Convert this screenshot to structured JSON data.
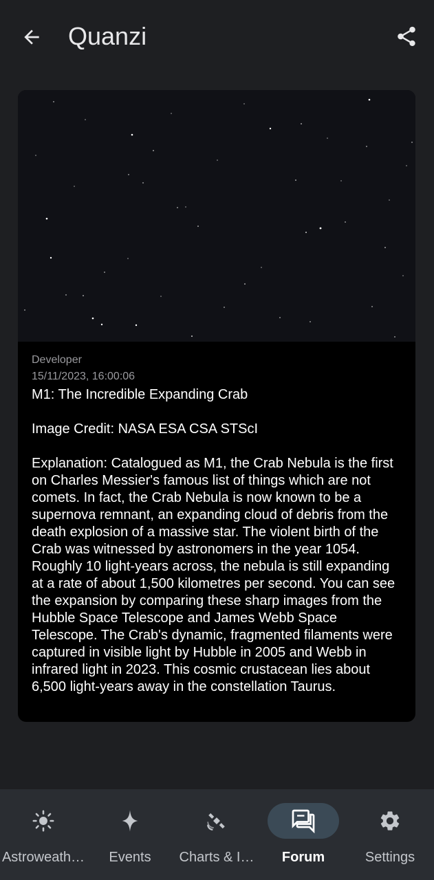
{
  "header": {
    "title": "Quanzi",
    "back_icon": "arrow-back-icon",
    "share_icon": "share-icon"
  },
  "post": {
    "image_alt": "starfield",
    "author": "Developer",
    "timestamp": "15/11/2023, 16:00:06",
    "text": "M1: The Incredible Expanding Crab\n\nImage Credit: NASA ESA CSA STScI\n\nExplanation: Catalogued as M1, the Crab Nebula is the first on Charles Messier's famous list of things which are not comets. In fact, the Crab Nebula is now known to be a supernova remnant, an expanding cloud of debris from the death explosion of a massive star. The violent birth of the Crab was witnessed by astronomers in the year 1054. Roughly 10 light-years across, the nebula is still expanding at a rate of about 1,500 kilometres per second. You can see the expansion by comparing these sharp images from the Hubble Space Telescope and James Webb Space Telescope. The Crab's dynamic, fragmented filaments were captured in visible light by Hubble in 2005 and Webb in infrared light in 2023. This cosmic crustacean lies about 6,500 light-years away in the constellation Taurus."
  },
  "nav": {
    "items": [
      {
        "label": "Astroweath…",
        "icon": "sun-icon"
      },
      {
        "label": "Events",
        "icon": "sparkle-icon"
      },
      {
        "label": "Charts & I…",
        "icon": "satellite-icon"
      },
      {
        "label": "Forum",
        "icon": "forum-icon",
        "active": true
      },
      {
        "label": "Settings",
        "icon": "gear-icon"
      }
    ]
  },
  "colors": {
    "background": "#1e1f22",
    "card": "#000000",
    "nav_background": "#2a2d32",
    "nav_active_pill": "#3b4a56"
  }
}
